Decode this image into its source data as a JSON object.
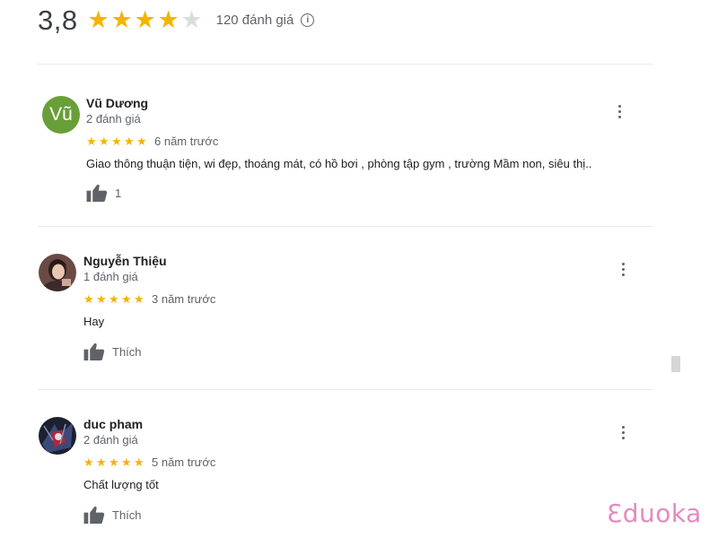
{
  "summary": {
    "rating": "3,8",
    "rating_value": 3.8,
    "stars_filled": 4,
    "stars_total": 5,
    "total_reviews": "120 đánh giá",
    "info_icon": "info-icon"
  },
  "reviews": [
    {
      "avatar_letter": "Vũ",
      "avatar_color": "#689f38",
      "author": "Vũ Dương",
      "count": "2 đánh giá",
      "stars": 5,
      "time": "6 năm trước",
      "text": "Giao thông thuận tiện, wi đẹp, thoáng mát, có hồ bơi , phòng tập gym , trường Mầm non, siêu thị..",
      "like": "1"
    },
    {
      "author": "Nguyễn Thiệu",
      "count": "1 đánh giá",
      "stars": 5,
      "time": "3 năm trước",
      "text": "Hay",
      "like": "Thích"
    },
    {
      "author": "duc pham",
      "count": "2 đánh giá",
      "stars": 5,
      "time": "5 năm trước",
      "text": "Chất lượng tốt",
      "like": "Thích"
    }
  ],
  "colors": {
    "star": "#f4b400",
    "star_empty": "#dadce0",
    "brand": "#e48ac1"
  },
  "brand": {
    "name": "Eduoka"
  }
}
